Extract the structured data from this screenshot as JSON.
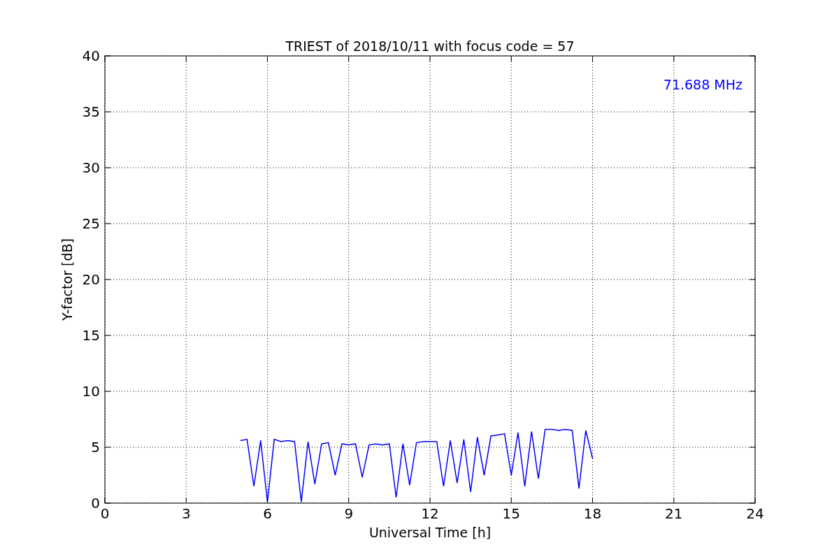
{
  "figure": {
    "chart_data": {
      "type": "line",
      "title": "TRIEST of 2018/10/11 with focus code = 57",
      "xlabel": "Universal Time [h]",
      "ylabel": "Y-factor [dB]",
      "xlim": [
        0,
        24
      ],
      "ylim": [
        0,
        40
      ],
      "xticks": [
        0,
        3,
        6,
        9,
        12,
        15,
        18,
        21,
        24
      ],
      "yticks": [
        0,
        5,
        10,
        15,
        20,
        25,
        30,
        35,
        40
      ],
      "x": [
        5,
        5.25,
        5.5,
        5.75,
        6,
        6.25,
        6.5,
        6.75,
        7,
        7.25,
        7.5,
        7.75,
        8,
        8.25,
        8.5,
        8.75,
        9,
        9.25,
        9.5,
        9.75,
        10,
        10.25,
        10.5,
        10.75,
        11,
        11.25,
        11.5,
        11.75,
        12,
        12.25,
        12.5,
        12.75,
        13,
        13.25,
        13.5,
        13.75,
        14,
        14.25,
        14.5,
        14.75,
        15,
        15.25,
        15.5,
        15.75,
        16,
        16.25,
        16.5,
        16.75,
        17,
        17.25,
        17.5,
        17.75,
        18
      ],
      "series": [
        {
          "name": "71.688 MHz",
          "color": "#0000ff",
          "values": [
            5.6,
            5.7,
            1.5,
            5.6,
            0.1,
            5.7,
            5.5,
            5.6,
            5.5,
            0.1,
            5.5,
            1.7,
            5.3,
            5.4,
            2.5,
            5.3,
            5.2,
            5.3,
            2.3,
            5.2,
            5.3,
            5.2,
            5.3,
            0.5,
            5.3,
            1.6,
            5.4,
            5.5,
            5.5,
            5.5,
            1.5,
            5.6,
            1.8,
            5.7,
            1.0,
            5.9,
            2.5,
            6.0,
            6.1,
            6.2,
            2.5,
            6.3,
            1.5,
            6.4,
            2.2,
            6.6,
            6.6,
            6.5,
            6.6,
            6.5,
            1.3,
            6.5,
            4.0
          ]
        }
      ],
      "grid": true
    }
  }
}
